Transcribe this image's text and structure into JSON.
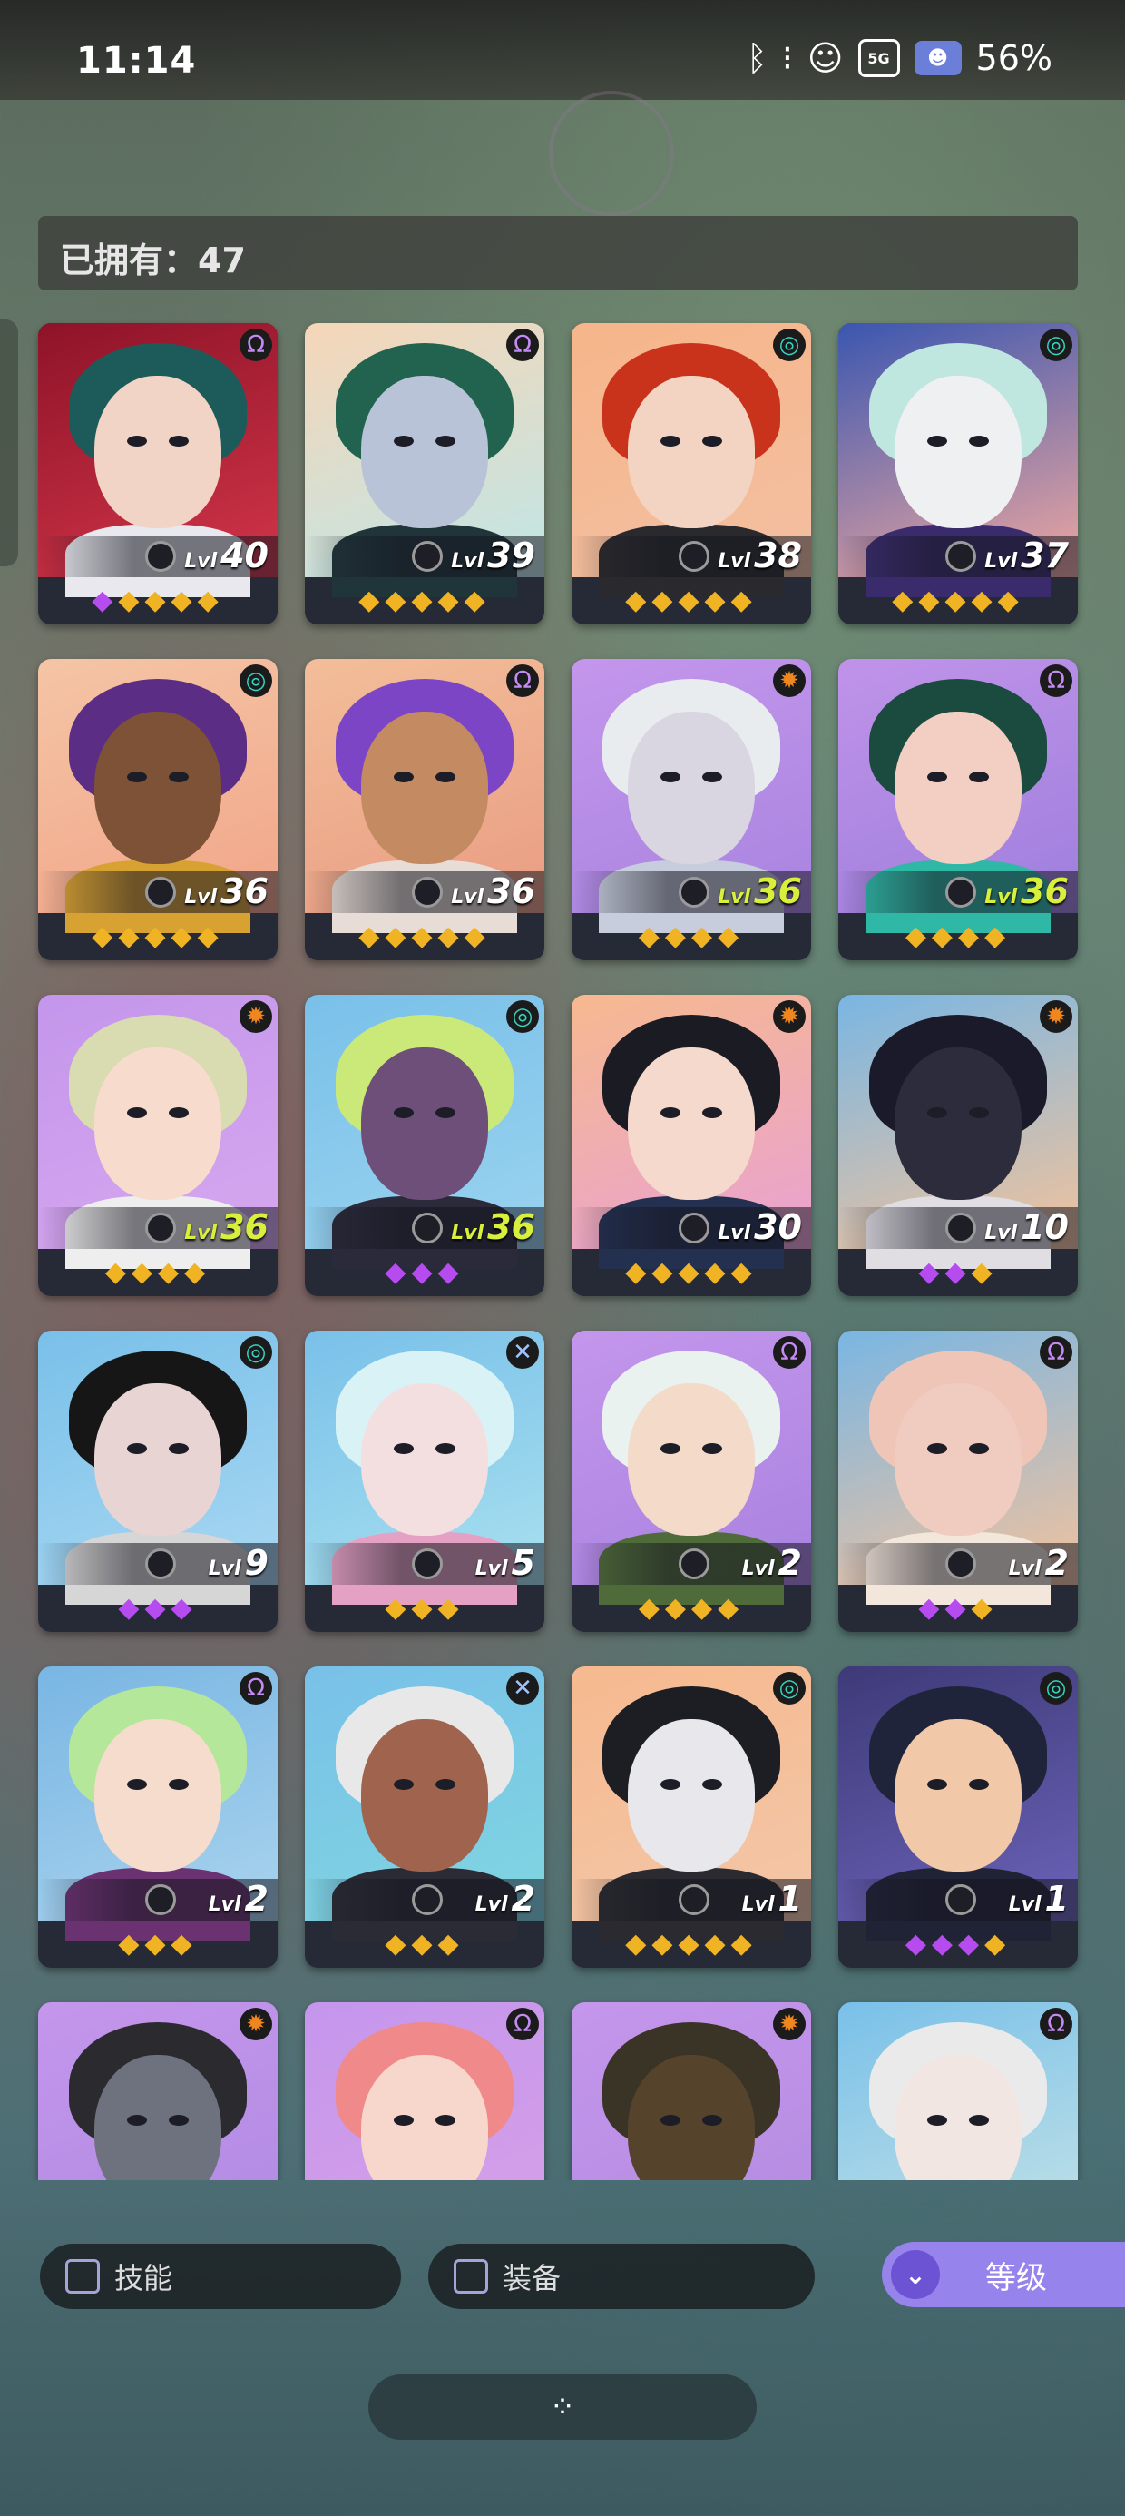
{
  "status_bar": {
    "time": "11:14",
    "network": "5G",
    "battery": "56%"
  },
  "owned": {
    "label": "已拥有：47"
  },
  "filters": {
    "skill": "技能",
    "equipment": "装备",
    "sort": "等级"
  },
  "colors": {
    "star_gold": "#f0b323",
    "star_purple": "#b64bf0",
    "level_highlight": "#d8ef3c",
    "sort_button": "#9783ec"
  },
  "heroes": [
    {
      "level": "40",
      "class_icon": "omega-icon",
      "stars": [
        "purple",
        "gold",
        "gold",
        "gold",
        "gold"
      ],
      "hi": false,
      "bg": [
        "#8e1328",
        "#d23549"
      ],
      "hair": "#1d5a5a",
      "skin": "#f1d4c6",
      "cloth": "#e8e8ee"
    },
    {
      "level": "39",
      "class_icon": "omega-icon",
      "stars": [
        "gold",
        "gold",
        "gold",
        "gold",
        "gold"
      ],
      "hi": false,
      "bg": [
        "#f6d6b8",
        "#bfe6e6"
      ],
      "hair": "#21634e",
      "skin": "#b9c3d8",
      "cloth": "#20353a"
    },
    {
      "level": "38",
      "class_icon": "spiral-icon",
      "stars": [
        "gold",
        "gold",
        "gold",
        "gold",
        "gold"
      ],
      "hi": false,
      "bg": [
        "#f6b58a",
        "#f3c0a2"
      ],
      "hair": "#c9331c",
      "skin": "#f3d4c2",
      "cloth": "#2a2a2e"
    },
    {
      "level": "37",
      "class_icon": "spiral-icon",
      "stars": [
        "gold",
        "gold",
        "gold",
        "gold",
        "gold"
      ],
      "hi": false,
      "bg": [
        "#3a56b0",
        "#f0a8a0"
      ],
      "hair": "#bfe6df",
      "skin": "#eef0f2",
      "cloth": "#3a2c6c"
    },
    {
      "level": "36",
      "class_icon": "spiral-icon",
      "stars": [
        "gold",
        "gold",
        "gold",
        "gold",
        "gold"
      ],
      "hi": false,
      "bg": [
        "#f4c5a6",
        "#f2a588"
      ],
      "hair": "#5b2d84",
      "skin": "#7d5236",
      "cloth": "#d8a233"
    },
    {
      "level": "36",
      "class_icon": "omega-icon",
      "stars": [
        "gold",
        "gold",
        "gold",
        "gold",
        "gold"
      ],
      "hi": false,
      "bg": [
        "#f3be9a",
        "#e99c82"
      ],
      "hair": "#7b45c6",
      "skin": "#c48a62",
      "cloth": "#e7ddd6"
    },
    {
      "level": "36",
      "class_icon": "sun-icon",
      "stars": [
        "gold",
        "gold",
        "gold",
        "gold"
      ],
      "hi": true,
      "bg": [
        "#c496ec",
        "#a884e0"
      ],
      "hair": "#e8ecef",
      "skin": "#d9d6e2",
      "cloth": "#c7cddc"
    },
    {
      "level": "36",
      "class_icon": "omega-icon",
      "stars": [
        "gold",
        "gold",
        "gold",
        "gold"
      ],
      "hi": true,
      "bg": [
        "#c093e9",
        "#9e7fdd"
      ],
      "hair": "#1b4a3e",
      "skin": "#f2cfc2",
      "cloth": "#2fb8a6"
    },
    {
      "level": "36",
      "class_icon": "sun-icon",
      "stars": [
        "gold",
        "gold",
        "gold",
        "gold"
      ],
      "hi": true,
      "bg": [
        "#c496ec",
        "#d6a7ee"
      ],
      "hair": "#d9dbb0",
      "skin": "#f7dbcc",
      "cloth": "#eeeeee"
    },
    {
      "level": "36",
      "class_icon": "spiral-icon",
      "stars": [
        "purple",
        "purple",
        "purple"
      ],
      "hi": true,
      "bg": [
        "#79c0e9",
        "#9ad3ef"
      ],
      "hair": "#cbe978",
      "skin": "#6e4f7a",
      "cloth": "#2b2a3a"
    },
    {
      "level": "30",
      "class_icon": "sun-icon",
      "stars": [
        "gold",
        "gold",
        "gold",
        "gold",
        "gold"
      ],
      "hi": false,
      "bg": [
        "#f6b98f",
        "#e9a1d3"
      ],
      "hair": "#1b1b24",
      "skin": "#f4d9cc",
      "cloth": "#243050"
    },
    {
      "level": "10",
      "class_icon": "sun-icon",
      "stars": [
        "purple",
        "purple",
        "gold"
      ],
      "hi": false,
      "bg": [
        "#79b6e3",
        "#f3c39c"
      ],
      "hair": "#1a1a2a",
      "skin": "#2c2c3c",
      "cloth": "#e0dde3"
    },
    {
      "level": "9",
      "class_icon": "spiral-icon",
      "stars": [
        "purple",
        "purple",
        "purple"
      ],
      "hi": false,
      "bg": [
        "#79c0e9",
        "#a8d7f2"
      ],
      "hair": "#161616",
      "skin": "#e9d4d4",
      "cloth": "#d6d6d6"
    },
    {
      "level": "5",
      "class_icon": "cross-icon",
      "stars": [
        "gold",
        "gold",
        "gold"
      ],
      "hi": false,
      "bg": [
        "#79c0e9",
        "#a8e0ef"
      ],
      "hair": "#d8f2f6",
      "skin": "#f4dfe0",
      "cloth": "#e4a1c4"
    },
    {
      "level": "2",
      "class_icon": "omega-icon",
      "stars": [
        "gold",
        "gold",
        "gold",
        "gold"
      ],
      "hi": false,
      "bg": [
        "#c496ec",
        "#a882e0"
      ],
      "hair": "#e9f2ee",
      "skin": "#f4dac9",
      "cloth": "#4f6b3a"
    },
    {
      "level": "2",
      "class_icon": "omega-icon",
      "stars": [
        "purple",
        "purple",
        "gold"
      ],
      "hi": false,
      "bg": [
        "#79b6e3",
        "#f2c29e"
      ],
      "hair": "#efc5b7",
      "skin": "#f0cbbf",
      "cloth": "#f3e6db"
    },
    {
      "level": "2",
      "class_icon": "omega-icon",
      "stars": [
        "gold",
        "gold",
        "gold"
      ],
      "hi": false,
      "bg": [
        "#79b6e3",
        "#a9d3ee"
      ],
      "hair": "#b5e79a",
      "skin": "#f5dccc",
      "cloth": "#6a3270"
    },
    {
      "level": "2",
      "class_icon": "cross-icon",
      "stars": [
        "gold",
        "gold",
        "gold"
      ],
      "hi": false,
      "bg": [
        "#79c0e9",
        "#7fd6e0"
      ],
      "hair": "#e8e8e8",
      "skin": "#a0644e",
      "cloth": "#2b2b35"
    },
    {
      "level": "1",
      "class_icon": "spiral-icon",
      "stars": [
        "gold",
        "gold",
        "gold",
        "gold",
        "gold"
      ],
      "hi": false,
      "bg": [
        "#f6b98f",
        "#f3c7a8"
      ],
      "hair": "#1d1d24",
      "skin": "#e8e8ec",
      "cloth": "#2a2a30"
    },
    {
      "level": "1",
      "class_icon": "spiral-icon",
      "stars": [
        "purple",
        "purple",
        "purple",
        "gold"
      ],
      "hi": false,
      "bg": [
        "#3e3a78",
        "#6b62b8"
      ],
      "hair": "#20243a",
      "skin": "#f2c9a8",
      "cloth": "#202236"
    },
    {
      "level": "",
      "class_icon": "sun-icon",
      "stars": [],
      "hi": false,
      "bg": [
        "#c496ec",
        "#b08ae2"
      ],
      "hair": "#2b2b2f",
      "skin": "#6e727e",
      "cloth": "#1b1b1f"
    },
    {
      "level": "",
      "class_icon": "omega-icon",
      "stars": [],
      "hi": false,
      "bg": [
        "#c496ec",
        "#d8a0e8"
      ],
      "hair": "#f08a8a",
      "skin": "#f7d6cc",
      "cloth": "#f3b2a8"
    },
    {
      "level": "",
      "class_icon": "sun-icon",
      "stars": [],
      "hi": false,
      "bg": [
        "#c496ec",
        "#b38be0"
      ],
      "hair": "#3a3426",
      "skin": "#56432c",
      "cloth": "#2a2a2a"
    },
    {
      "level": "",
      "class_icon": "omega-icon",
      "stars": [],
      "hi": false,
      "bg": [
        "#79c0e9",
        "#c7e4e6"
      ],
      "hair": "#eaeaea",
      "skin": "#f2e6e2",
      "cloth": "#e2e2e2"
    }
  ]
}
